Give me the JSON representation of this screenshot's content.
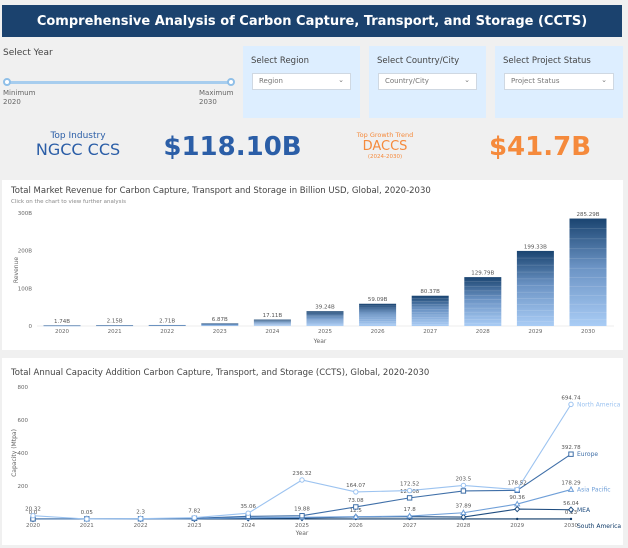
{
  "header": {
    "title": "Comprehensive Analysis of Carbon Capture, Transport, and Storage (CCTS)"
  },
  "filters": {
    "year": {
      "label": "Select Year",
      "min_label": "Minimum",
      "min_value": "2020",
      "max_label": "Maximum",
      "max_value": "2030"
    },
    "region": {
      "label": "Select Region",
      "placeholder": "Region"
    },
    "country": {
      "label": "Select Country/City",
      "placeholder": "Country/City"
    },
    "status": {
      "label": "Select Project Status",
      "placeholder": "Project Status"
    },
    "chevron": "⌄"
  },
  "kpis": {
    "top_industry_label": "Top Industry",
    "top_industry_value": "NGCC CCS",
    "top_industry_revenue": "$118.10B",
    "top_growth_label": "Top Growth Trend",
    "top_growth_value": "DACCS",
    "top_growth_period": "(2024-2030)",
    "top_growth_revenue": "$41.7B"
  },
  "colors": {
    "header": "#1b426e",
    "kpi_blue": "#2b5ea7",
    "kpi_orange": "#f58a3c",
    "bar_top": "#1a4470",
    "bar_bottom": "#a9ccf5"
  },
  "chart_data": [
    {
      "type": "bar",
      "title": "Total Market Revenue for Carbon Capture, Transport and Storage in Billion USD, Global, 2020-2030",
      "subtitle": "Click on the chart to view further analysis",
      "xlabel": "Year",
      "ylabel": "Revenue",
      "categories": [
        "2020",
        "2021",
        "2022",
        "2023",
        "2024",
        "2025",
        "2026",
        "2027",
        "2028",
        "2029",
        "2030"
      ],
      "values": [
        1.74,
        2.15,
        2.71,
        6.87,
        17.11,
        39.24,
        59.09,
        80.37,
        129.79,
        199.33,
        285.29
      ],
      "data_labels": [
        "1.74B",
        "2.15B",
        "2.71B",
        "6.87B",
        "17.11B",
        "39.24B",
        "59.09B",
        "80.37B",
        "129.79B",
        "199.33B",
        "285.29B"
      ],
      "yticks": [
        0,
        100,
        200,
        300
      ],
      "ytick_labels": [
        "0",
        "100B",
        "200B",
        "300B"
      ],
      "ylim": [
        0,
        300
      ],
      "grid": false,
      "stacked": true
    },
    {
      "type": "line",
      "title": "Total Annual Capacity Addition Carbon Capture, Transport, and Storage (CCTS), Global, 2020-2030",
      "xlabel": "Year",
      "ylabel": "Capacity (Mtpa)",
      "x": [
        "2020",
        "2021",
        "2022",
        "2023",
        "2024",
        "2025",
        "2026",
        "2027",
        "2028",
        "2029",
        "2030"
      ],
      "yticks": [
        0,
        200,
        400,
        600,
        800
      ],
      "ytick_labels": [
        "0",
        "200",
        "400",
        "600",
        "800"
      ],
      "ylim": [
        0,
        800
      ],
      "legend": "right-end-labels",
      "series": [
        {
          "name": "North America",
          "color": "#9cc3f0",
          "marker": "circle",
          "values": [
            20.32,
            0.05,
            2.3,
            7.82,
            35.06,
            236.32,
            164.07,
            172.52,
            203.5,
            178.52,
            694.74
          ],
          "labels": [
            "20.32",
            "0.05",
            "2.3",
            "7.82",
            "35.06",
            "236.32",
            "164.07",
            "172.52",
            "203.5",
            "178.52",
            "694.74"
          ]
        },
        {
          "name": "Europe",
          "color": "#3f6fa8",
          "marker": "square",
          "values": [
            0.5,
            0.8,
            1.2,
            4.0,
            16.0,
            19.88,
            73.08,
            128.08,
            170.0,
            174.0,
            392.78
          ],
          "labels": [
            "",
            "",
            "",
            "",
            "",
            "19.88",
            "73.08",
            "128.08",
            "",
            "",
            "392.78"
          ]
        },
        {
          "name": "Asia Pacific",
          "color": "#6f9fd8",
          "marker": "triangle",
          "values": [
            0.2,
            0.3,
            0.5,
            2.0,
            8.0,
            10.0,
            14.0,
            17.8,
            37.89,
            90.36,
            178.29
          ],
          "labels": [
            "",
            "",
            "",
            "",
            "",
            "",
            "",
            "17.8",
            "37.89",
            "90.36",
            "178.29"
          ]
        },
        {
          "name": "MEA",
          "color": "#1f4d80",
          "marker": "diamond",
          "values": [
            0.0,
            0.0,
            0.2,
            1.0,
            4.0,
            6.0,
            12.5,
            14.0,
            12.0,
            60.0,
            56.04
          ],
          "labels": [
            "0.0",
            "",
            "",
            "",
            "",
            "",
            "12.5",
            "",
            "",
            "",
            "56.04"
          ]
        },
        {
          "name": "South America",
          "color": "#0f3a68",
          "marker": "dot",
          "values": [
            0.0,
            0.0,
            0.0,
            0.0,
            0.1,
            0.1,
            0.1,
            0.1,
            0.1,
            0.1,
            0.23
          ],
          "labels": [
            "",
            "",
            "",
            "",
            "",
            "",
            "",
            "",
            "",
            "",
            "0.23"
          ]
        }
      ]
    }
  ]
}
